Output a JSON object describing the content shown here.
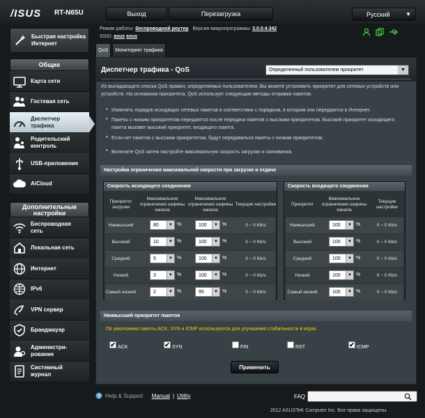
{
  "brand": {
    "logo": "/ISUS",
    "model": "RT-N65U"
  },
  "top": {
    "logout": "Выход",
    "reboot": "Перезагрузка",
    "language": "Русский"
  },
  "info": {
    "mode_label": "Режим работы:",
    "mode_value": "беспроводной роутер",
    "fw_label": "Версия микропрограммы:",
    "fw_value": "3.0.0.4.342",
    "ssid_label": "SSID:",
    "ssid1": "asus",
    "ssid2": "asus"
  },
  "sidebar": {
    "qis": "Быстрая настройка Интернет",
    "general": "Общие",
    "general_items": [
      {
        "label": "Карта сети",
        "icon": "network-map-icon"
      },
      {
        "label": "Гостевая сеть",
        "icon": "guest-network-icon"
      },
      {
        "label": "Диспетчер трафика",
        "icon": "traffic-manager-icon"
      },
      {
        "label": "Родительский контроль",
        "icon": "parental-control-icon"
      },
      {
        "label": "USB-приложение",
        "icon": "usb-icon"
      },
      {
        "label": "AiCloud",
        "icon": "cloud-icon"
      }
    ],
    "advanced": "Дополнительные настройки",
    "advanced_items": [
      {
        "label": "Беспроводная сеть",
        "icon": "wireless-icon"
      },
      {
        "label": "Локальная сеть",
        "icon": "lan-icon"
      },
      {
        "label": "Интернет",
        "icon": "wan-icon"
      },
      {
        "label": "IPv6",
        "icon": "ipv6-icon"
      },
      {
        "label": "VPN сервер",
        "icon": "vpn-icon"
      },
      {
        "label": "Брандмауэр",
        "icon": "firewall-icon"
      },
      {
        "label": "Администри-рование",
        "icon": "admin-icon"
      },
      {
        "label": "Системный журнал",
        "icon": "syslog-icon"
      }
    ]
  },
  "tabs": {
    "qos": "QoS",
    "monitor": "Мониторинг трафика"
  },
  "page": {
    "title": "Диспетчер трафика - QoS",
    "mode_select": "Определенный пользователем приоритет",
    "desc": "Из выпадающего списка QoS правил, определяемых пользователем, Вы можете установить приоритет для сетевых устройств или устройств. На основании приоритета, QoS использует следующие методы отправки пакетов:",
    "bullets": [
      "Изменить порядок исходящих сетевых пакетов в соответствии с порядком, в котором они передаются в Интернет.",
      "Пакеты с низким приоритетом передаются после передачи пакетов с высоким приоритетом. Высокий приоритет исходящего пакета вызовет высокий приоритет, входящего пакета.",
      "Если нет пакетов с высоким приоритетом, будут передаваться пакеты с низким приоритетом."
    ],
    "hint": "Включите QoS затем настройте максимальную скорость загрузки и скачивания."
  },
  "limits": {
    "section": "Настройка ограничения максимальной скорости при загрузке и отдаче",
    "upload": {
      "title": "Скорость исходящего соединения",
      "headers": [
        "Приоритет загрузки",
        "Максимальное ограничение ширины канала",
        "Максимальное ограничение ширины канала",
        "Текущие настройки"
      ],
      "rows": [
        {
          "priority": "Наивысший",
          "min": "80",
          "max": "100",
          "current": "0 ~ 0 Kb/s"
        },
        {
          "priority": "Высокий",
          "min": "10",
          "max": "100",
          "current": "0 ~ 0 Kb/s"
        },
        {
          "priority": "Средний",
          "min": "5",
          "max": "100",
          "current": "0 ~ 0 Kb/s"
        },
        {
          "priority": "Низкий",
          "min": "3",
          "max": "100",
          "current": "0 ~ 0 Kb/s"
        },
        {
          "priority": "Самый низкий",
          "min": "2",
          "max": "95",
          "current": "0 ~ 0 Kb/s"
        }
      ]
    },
    "download": {
      "title": "Скорость входящего соединения",
      "headers": [
        "Приоритет",
        "Максимальное ограничение ширины канала",
        "Текущие настройки"
      ],
      "rows": [
        {
          "priority": "Наивысший",
          "max": "100",
          "current": "0 ~ 0 Kb/s"
        },
        {
          "priority": "Высокий",
          "max": "100",
          "current": "0 ~ 0 Kb/s"
        },
        {
          "priority": "Средний",
          "max": "100",
          "current": "0 ~ 0 Kb/s"
        },
        {
          "priority": "Низкий",
          "max": "100",
          "current": "0 ~ 0 Kb/s"
        },
        {
          "priority": "Самый низкий",
          "max": "100",
          "current": "0 ~ 0 Kb/s"
        }
      ]
    },
    "percent": "%"
  },
  "highest": {
    "section": "Наивысший приоритет пакетов",
    "note": "По умолчанию пакеты ACK, SYN и ICMP используются для улучшения стабильности в играх.",
    "checks": [
      {
        "label": "ACK",
        "checked": true
      },
      {
        "label": "SYN",
        "checked": true
      },
      {
        "label": "FIN",
        "checked": false
      },
      {
        "label": "RST",
        "checked": false
      },
      {
        "label": "ICMP",
        "checked": true
      }
    ]
  },
  "apply": "Применить",
  "footer": {
    "help": "Help & Support",
    "manual": "Manual",
    "sep": "|",
    "utility": "Utility",
    "faq": "FAQ",
    "copyright": "2012 ASUSTeK Computer Inc. Все права защищены."
  }
}
